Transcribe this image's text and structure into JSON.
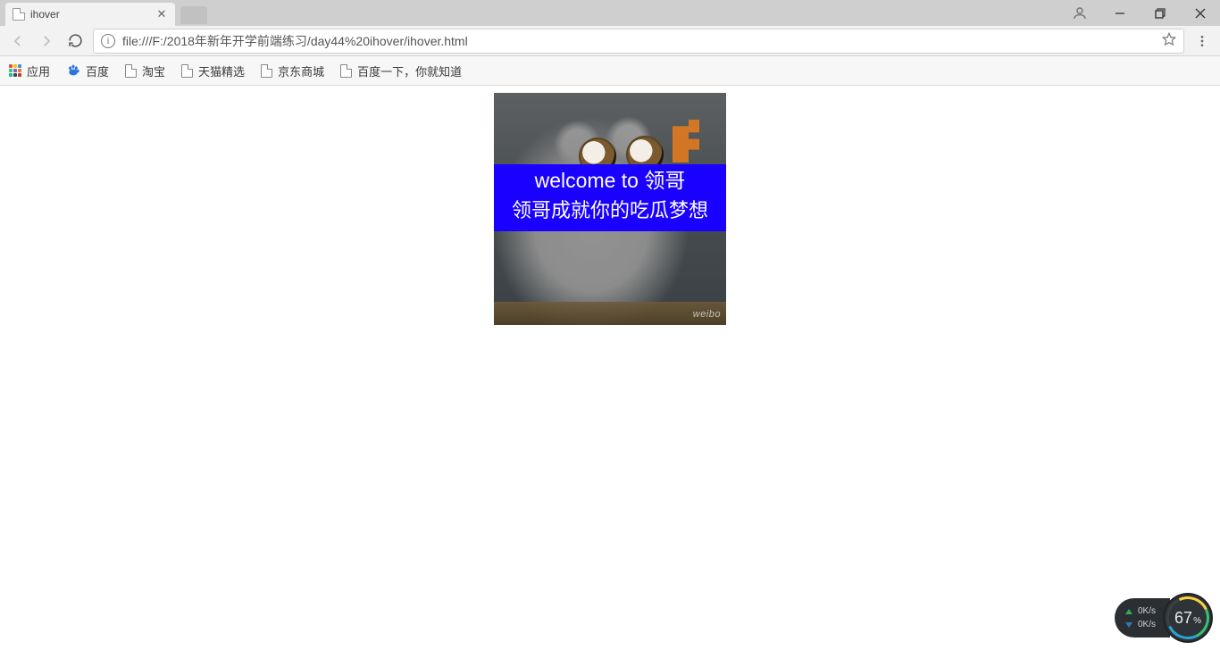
{
  "window": {
    "tab_title": "ihover",
    "url": "file:///F:/2018年新年开学前端练习/day44%20ihover/ihover.html"
  },
  "bookmarks": {
    "apps": "应用",
    "items": [
      "百度",
      "淘宝",
      "天猫精选",
      "京东商城",
      "百度一下，你就知道"
    ]
  },
  "content": {
    "heading": "welcome to 领哥",
    "subline": "领哥成就你的吃瓜梦想",
    "watermark": "weibo"
  },
  "netwidget": {
    "up": "0K/s",
    "down": "0K/s",
    "pct": "67",
    "pct_suffix": "%"
  }
}
